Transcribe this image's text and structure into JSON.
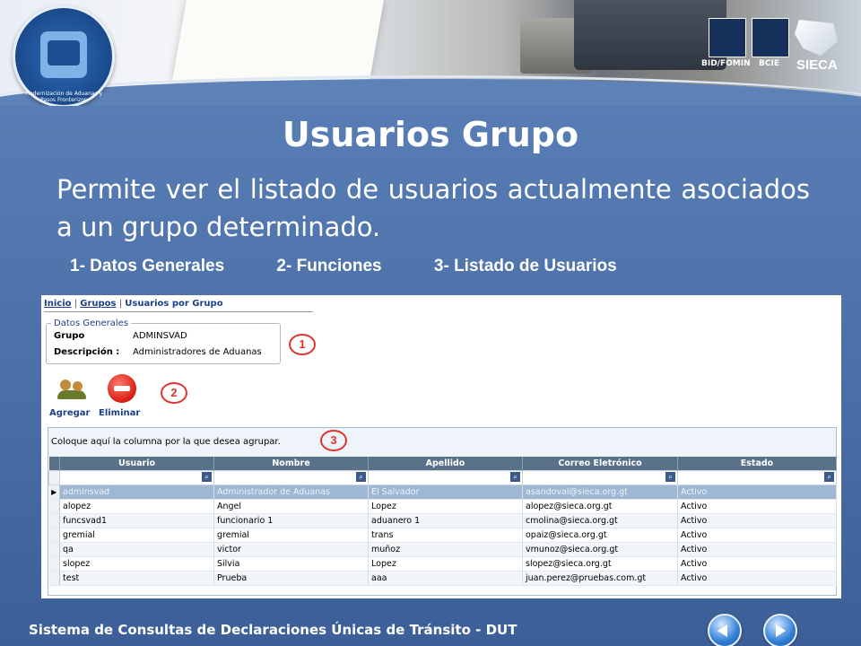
{
  "slide": {
    "title": "Usuarios Grupo",
    "description": "Permite ver el listado de usuarios actualmente asociados a un  grupo determinado.",
    "sections": [
      "1- Datos Generales",
      "2- Funciones",
      "3- Listado de Usuarios"
    ],
    "footer": "Sistema de Consultas de Declaraciones Únicas de Tránsito - DUT"
  },
  "header": {
    "logo_text": "Modernización de Aduanas y Pasos Fronterizos",
    "partners": [
      "BID/FOMIN",
      "BCIE",
      "SIECA"
    ]
  },
  "screenshot": {
    "breadcrumb": {
      "home": "Inicio",
      "sep": "|",
      "groups": "Grupos",
      "current": "Usuarios por Grupo"
    },
    "general_data": {
      "legend": "Datos Generales",
      "group_label": "Grupo",
      "group_value": "ADMINSVAD",
      "description_label": "Descripción :",
      "description_value": "Administradores de Aduanas"
    },
    "markers": [
      "1",
      "2",
      "3"
    ],
    "actions": {
      "add_label": "Agregar",
      "remove_label": "Eliminar"
    },
    "grid": {
      "group_hint": "Coloque aquí la columna por la que desea agrupar.",
      "columns": [
        "Usuario",
        "Nombre",
        "Apellido",
        "Correo Eletrónico",
        "Estado"
      ],
      "rows": [
        [
          "adminsvad",
          "Administrador de Aduanas",
          "El Salvador",
          "asandoval@sieca.org.gt",
          "Activo"
        ],
        [
          "alopez",
          "Angel",
          "Lopez",
          "alopez@sieca.org.gt",
          "Activo"
        ],
        [
          "funcsvad1",
          "funcionario 1",
          "aduanero 1",
          "cmolina@sieca.org.gt",
          "Activo"
        ],
        [
          "gremial",
          "gremial",
          "trans",
          "opaiz@sieca.org.gt",
          "Activo"
        ],
        [
          "qa",
          "victor",
          "muñoz",
          "vmunoz@sieca.org.gt",
          "Activo"
        ],
        [
          "slopez",
          "Silvia",
          "Lopez",
          "slopez@sieca.org.gt",
          "Activo"
        ],
        [
          "test",
          "Prueba",
          "aaa",
          "juan.perez@pruebas.com.gt",
          "Activo"
        ]
      ],
      "selected_row": 0
    }
  },
  "icons": [
    "users-icon",
    "remove-icon",
    "search-icon",
    "row-pointer-icon",
    "prev-icon",
    "next-icon"
  ],
  "colors": {
    "background": "#5d82b8",
    "grid_header": "#5a7289",
    "marker": "#e0332e",
    "link": "#1b3f8c"
  }
}
